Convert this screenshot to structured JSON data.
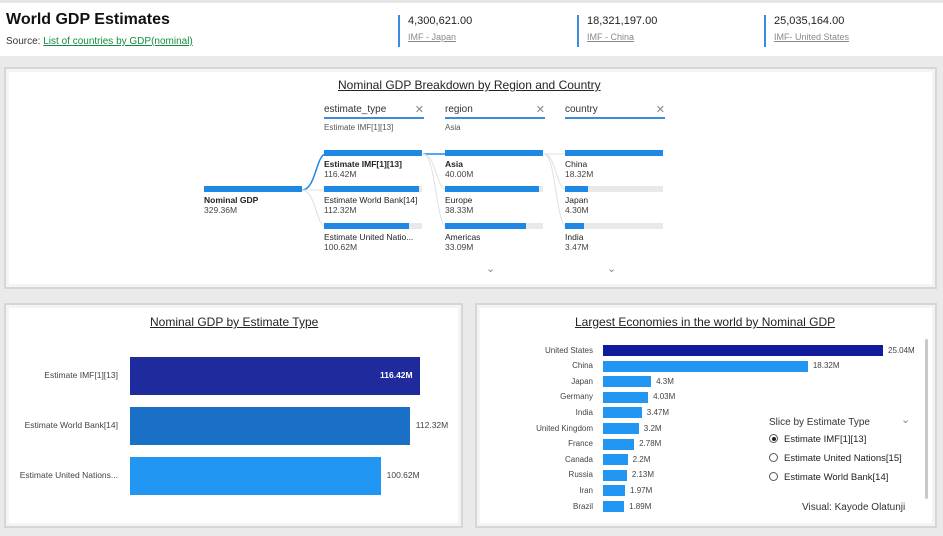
{
  "header": {
    "title": "World GDP Estimates",
    "source_prefix": "Source: ",
    "source_link": "List of countries by GDP(nominal)",
    "kpis": [
      {
        "value": "4,300,621.00",
        "label": "IMF - Japan"
      },
      {
        "value": "18,321,197.00",
        "label": "IMF - China"
      },
      {
        "value": "25,035,164.00",
        "label": "IMF- United States"
      }
    ]
  },
  "decomp": {
    "title": "Nominal GDP Breakdown by Region and Country",
    "root": {
      "label": "Nominal GDP",
      "value": "329.36M"
    },
    "columns": [
      {
        "header": "estimate_type",
        "filter": "Estimate IMF[1][13]",
        "nodes": [
          {
            "label": "Estimate IMF[1][13]",
            "value": "116.42M",
            "fraction": 1.0,
            "selected": true
          },
          {
            "label": "Estimate World Bank[14]",
            "value": "112.32M",
            "fraction": 0.965,
            "selected": false
          },
          {
            "label": "Estimate United Natio...",
            "value": "100.62M",
            "fraction": 0.864,
            "selected": false
          }
        ]
      },
      {
        "header": "region",
        "filter": "Asia",
        "nodes": [
          {
            "label": "Asia",
            "value": "40.00M",
            "fraction": 1.0,
            "selected": true
          },
          {
            "label": "Europe",
            "value": "38.33M",
            "fraction": 0.958,
            "selected": false
          },
          {
            "label": "Americas",
            "value": "33.09M",
            "fraction": 0.827,
            "selected": false
          }
        ]
      },
      {
        "header": "country",
        "filter": "",
        "nodes": [
          {
            "label": "China",
            "value": "18.32M",
            "fraction": 1.0,
            "selected": false
          },
          {
            "label": "Japan",
            "value": "4.30M",
            "fraction": 0.235,
            "selected": false
          },
          {
            "label": "India",
            "value": "3.47M",
            "fraction": 0.189,
            "selected": false
          }
        ]
      }
    ],
    "close_icon": "close-icon",
    "expand_icon": "chevron-down-icon"
  },
  "chart_data": [
    {
      "type": "bar",
      "title": "Nominal GDP by Estimate Type",
      "categories": [
        "Estimate IMF[1][13]",
        "Estimate World Bank[14]",
        "Estimate United Nations..."
      ],
      "values": [
        116.42,
        112.32,
        100.62
      ],
      "value_labels": [
        "116.42M",
        "112.32M",
        "100.62M"
      ],
      "colors": [
        "#1f2b9c",
        "#1a6fc7",
        "#2196f3"
      ],
      "orientation": "horizontal"
    },
    {
      "type": "bar",
      "title": "Largest Economies in the world by Nominal GDP",
      "categories": [
        "United States",
        "China",
        "Japan",
        "Germany",
        "India",
        "United Kingdom",
        "France",
        "Canada",
        "Russia",
        "Iran",
        "Brazil"
      ],
      "values": [
        25.04,
        18.32,
        4.3,
        4.03,
        3.47,
        3.2,
        2.78,
        2.2,
        2.13,
        1.97,
        1.89
      ],
      "value_labels": [
        "25.04M",
        "18.32M",
        "4.3M",
        "4.03M",
        "3.47M",
        "3.2M",
        "2.78M",
        "2.2M",
        "2.13M",
        "1.97M",
        "1.89M"
      ],
      "colors": [
        "#0f1b9a",
        "#2196f3"
      ],
      "orientation": "horizontal"
    }
  ],
  "slicer": {
    "title": "Slice by Estimate Type",
    "options": [
      {
        "label": "Estimate IMF[1][13]",
        "selected": true
      },
      {
        "label": "Estimate United Nations[15]",
        "selected": false
      },
      {
        "label": "Estimate World Bank[14]",
        "selected": false
      }
    ]
  },
  "credit": "Visual: Kayode Olatunji"
}
